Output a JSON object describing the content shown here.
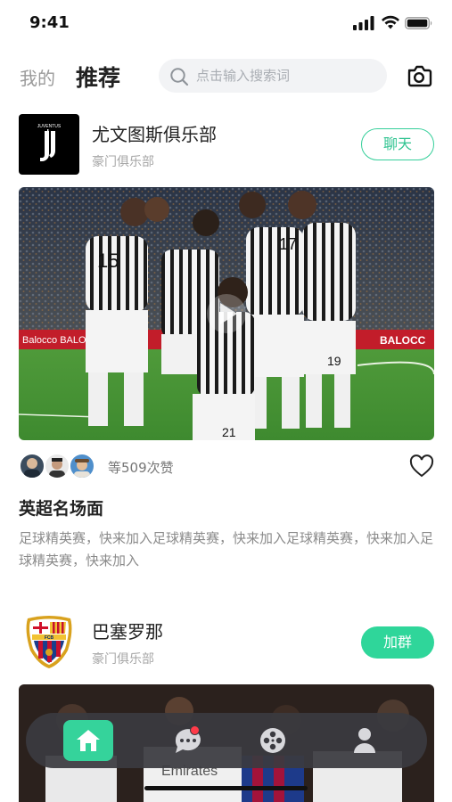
{
  "status": {
    "time": "9:41"
  },
  "header": {
    "tab_mine": "我的",
    "tab_recommend": "推荐",
    "search_placeholder": "点击输入搜索词"
  },
  "feed": [
    {
      "club_name": "尤文图斯俱乐部",
      "club_subtitle": "豪门俱乐部",
      "action_label": "聊天",
      "likes_text": "等509次赞",
      "post_title": "英超名场面",
      "post_desc": "足球精英赛，快来加入足球精英赛，快来加入足球精英赛，快来加入足球精英赛，快来加入"
    },
    {
      "club_name": "巴塞罗那",
      "club_subtitle": "豪门俱乐部",
      "action_label": "加群"
    }
  ],
  "tabbar": {
    "items": [
      "home-icon",
      "message-icon",
      "film-reel-icon",
      "profile-icon"
    ],
    "active": "home-icon",
    "has_unread_dot": true
  },
  "colors": {
    "accent": "#35d39b",
    "badge": "#ff3b49",
    "tabbar_bg": "#3a3a40"
  }
}
